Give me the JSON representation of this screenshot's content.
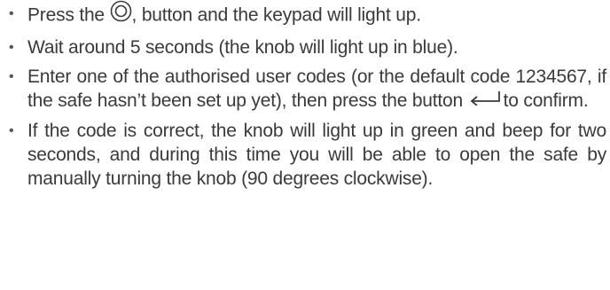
{
  "instructions": [
    {
      "before": "Press the ",
      "icon": "power-ring-icon",
      "after": ", button and the keypad will light up."
    },
    {
      "text": "Wait around 5 seconds (the knob will light up in blue)."
    },
    {
      "before": "Enter one of the authorised user codes (or the default code 1234567, if the safe hasn’t been set up yet), then press the button ",
      "icon": "enter-arrow-icon",
      "after": "to confirm."
    },
    {
      "text": "If the code is correct, the knob will light up in green and beep for two seconds, and during this time you will be able to open the safe by manually turning the knob (90 degrees clockwise)."
    }
  ],
  "bullet": "•",
  "colors": {
    "text": "#3a3a3a",
    "background": "#ffffff"
  }
}
